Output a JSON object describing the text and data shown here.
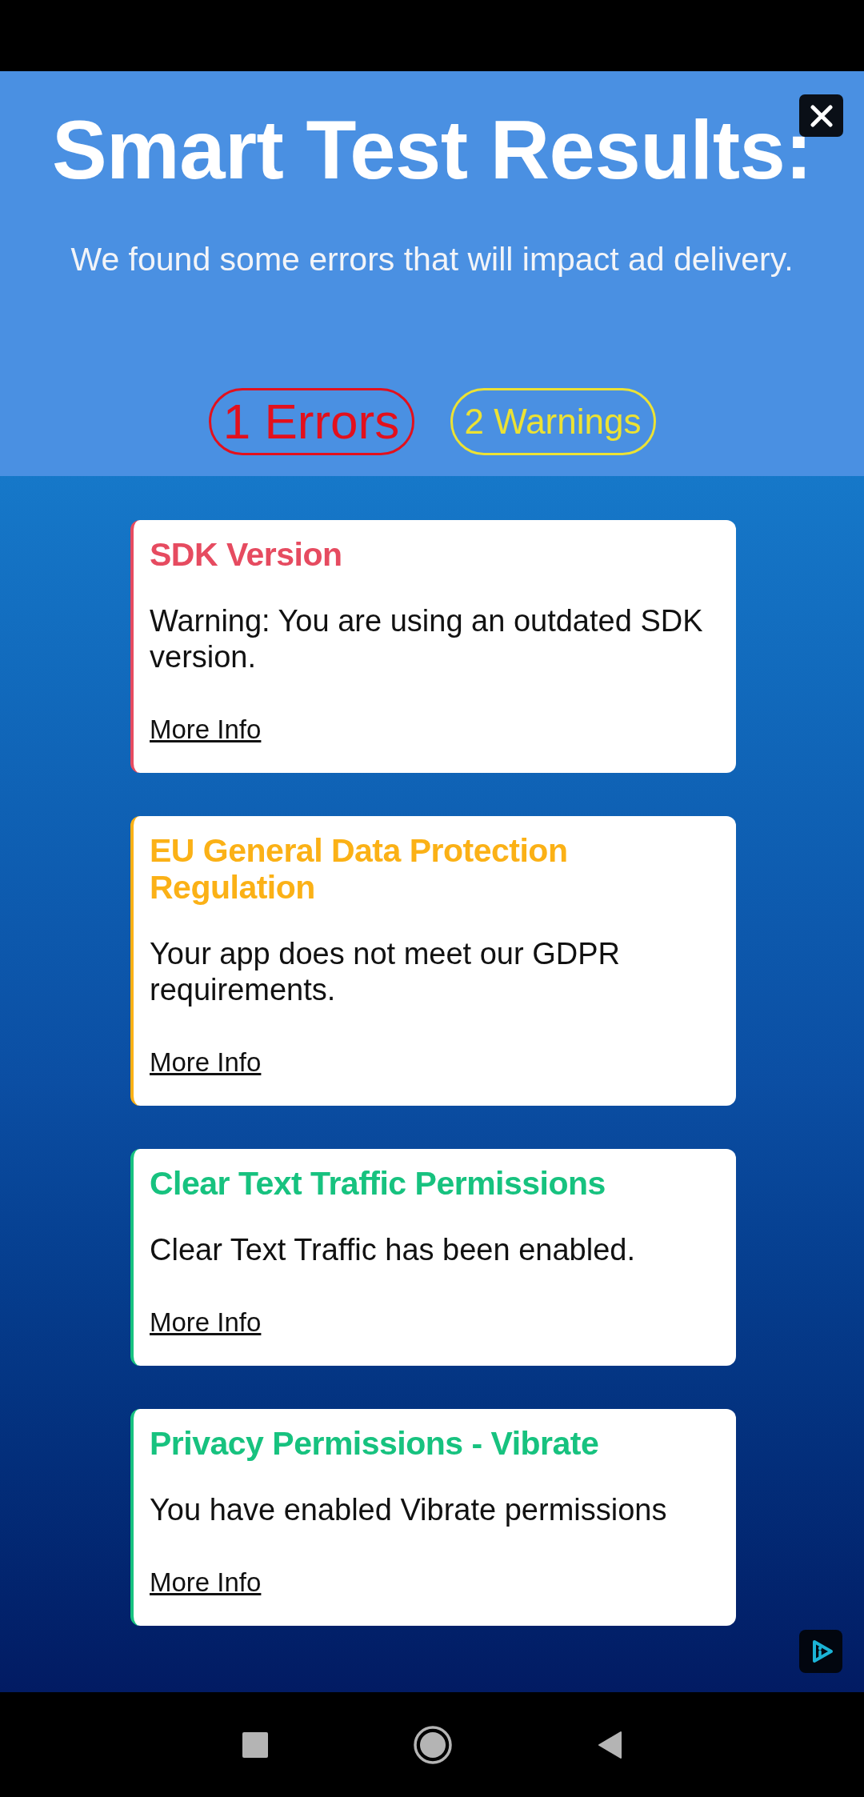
{
  "header": {
    "title": "Smart Test Results:",
    "subtitle": "We found some errors that will impact ad delivery."
  },
  "summary": [
    {
      "label": "1 Errors",
      "kind": "error"
    },
    {
      "label": "2 Warnings",
      "kind": "warning"
    }
  ],
  "issues": [
    {
      "title": "SDK Version",
      "message": "Warning: You are using an outdated SDK version.",
      "link": "More Info",
      "color": "#e64b60"
    },
    {
      "title": "EU General Data Protection Regulation",
      "message": "Your app does not meet our GDPR requirements.",
      "link": "More Info",
      "color": "#fbb116"
    },
    {
      "title": "Clear Text Traffic Permissions",
      "message": "Clear Text Traffic has been enabled.",
      "link": "More Info",
      "color": "#17c27f"
    },
    {
      "title": "Privacy Permissions - Vibrate",
      "message": "You have enabled Vibrate permissions",
      "link": "More Info",
      "color": "#17c27f"
    }
  ]
}
